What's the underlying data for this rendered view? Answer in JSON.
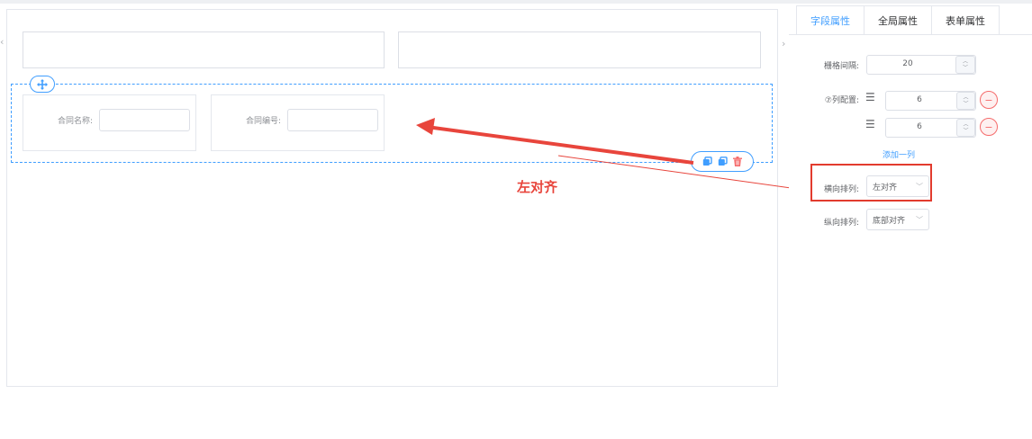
{
  "canvas": {
    "fields": [
      {
        "label": "合同名称:",
        "value": ""
      },
      {
        "label": "合同编号:",
        "value": ""
      }
    ],
    "drag_icon": "move-icon",
    "toolbar_icons": [
      "copy-icon",
      "copy-icon",
      "delete-icon"
    ]
  },
  "annotation": {
    "text": "左对齐",
    "color": "#e8453c"
  },
  "properties": {
    "tabs": [
      {
        "label": "字段属性",
        "active": true
      },
      {
        "label": "全局属性",
        "active": false
      },
      {
        "label": "表单属性",
        "active": false
      }
    ],
    "gutter": {
      "label": "栅格间隔:",
      "value": "20"
    },
    "columns": {
      "label": "⑦列配置:",
      "items": [
        {
          "value": "6"
        },
        {
          "value": "6"
        }
      ],
      "add_label": "添加一列"
    },
    "justify": {
      "label": "横向排列:",
      "value": "左对齐"
    },
    "align": {
      "label": "纵向排列:",
      "value": "底部对齐"
    }
  },
  "colors": {
    "accent": "#409eff",
    "danger": "#f56c6c",
    "annotation": "#e23b2e"
  }
}
